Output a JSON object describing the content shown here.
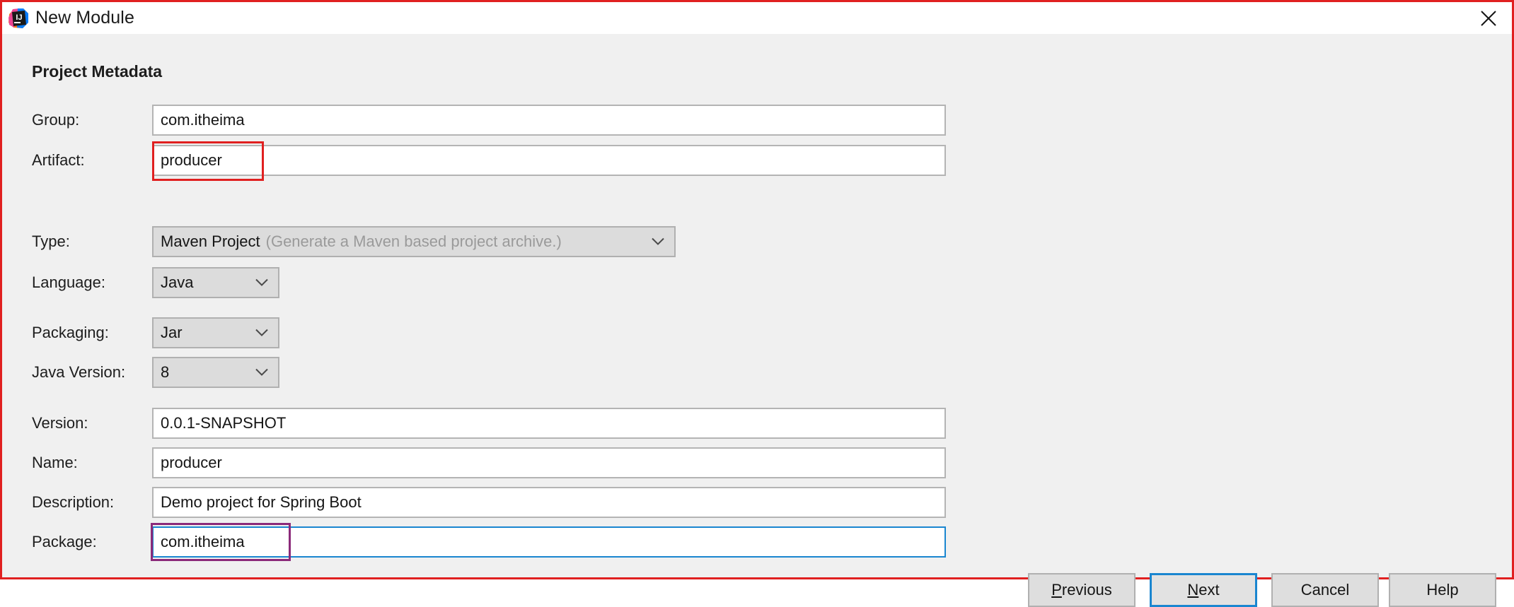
{
  "window": {
    "title": "New Module",
    "app_icon": "intellij-idea-icon",
    "close_icon": "close-icon",
    "border_color": "#e02020"
  },
  "form": {
    "section_title": "Project Metadata",
    "fields": {
      "group": {
        "label": "Group:",
        "value": "com.itheima"
      },
      "artifact": {
        "label": "Artifact:",
        "value": "producer"
      },
      "type": {
        "label": "Type:",
        "value": "Maven Project",
        "hint": "(Generate a Maven based project archive.)"
      },
      "language": {
        "label": "Language:",
        "value": "Java"
      },
      "packaging": {
        "label": "Packaging:",
        "value": "Jar"
      },
      "java_version": {
        "label": "Java Version:",
        "value": "8"
      },
      "version": {
        "label": "Version:",
        "value": "0.0.1-SNAPSHOT"
      },
      "name": {
        "label": "Name:",
        "value": "producer"
      },
      "description": {
        "label": "Description:",
        "value": "Demo project for Spring Boot"
      },
      "package": {
        "label": "Package:",
        "value": "com.itheima"
      }
    }
  },
  "buttons": {
    "previous": {
      "prefix": "",
      "mnemonic": "P",
      "suffix": "revious"
    },
    "next": {
      "prefix": "",
      "mnemonic": "N",
      "suffix": "ext"
    },
    "cancel": {
      "label": "Cancel"
    },
    "help": {
      "label": "Help"
    }
  },
  "colors": {
    "annotation_red": "#e02020",
    "focus_blue": "#1a86d0",
    "annotation_purple": "#8b2a7a",
    "dialog_bg": "#f0f0f0"
  }
}
